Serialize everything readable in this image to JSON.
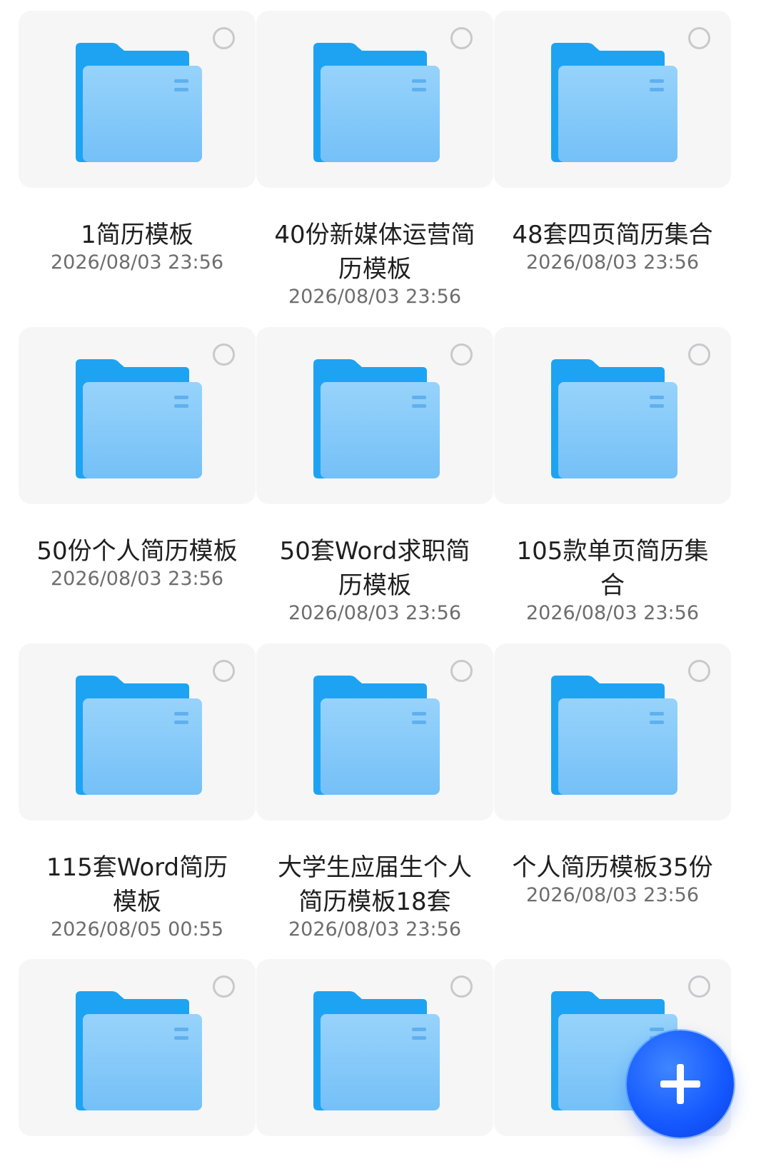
{
  "files": [
    {
      "name": "1简历模板",
      "date": "2026/08/03 23:56"
    },
    {
      "name": "40份新媒体运营简历模板",
      "date": "2026/08/03 23:56"
    },
    {
      "name": "48套四页简历集合",
      "date": "2026/08/03 23:56"
    },
    {
      "name": "50份个人简历模板",
      "date": "2026/08/03 23:56"
    },
    {
      "name": "50套Word求职简历模板",
      "date": "2026/08/03 23:56"
    },
    {
      "name": "105款单页简历集合",
      "date": "2026/08/03 23:56"
    },
    {
      "name": "115套Word简历模板",
      "date": "2026/08/05 00:55"
    },
    {
      "name": "大学生应届生个人简历模板18套",
      "date": "2026/08/03 23:56"
    },
    {
      "name": "个人简历模板35份",
      "date": "2026/08/03 23:56"
    },
    {
      "name": "",
      "date": ""
    },
    {
      "name": "",
      "date": ""
    },
    {
      "name": "",
      "date": ""
    }
  ],
  "icons": {
    "folder": "folder-icon",
    "select": "select-circle-icon",
    "add": "plus-icon"
  },
  "colors": {
    "folder_back": "#1ea3f3",
    "folder_front": "#88cdfb",
    "fab": "#1458ff"
  }
}
